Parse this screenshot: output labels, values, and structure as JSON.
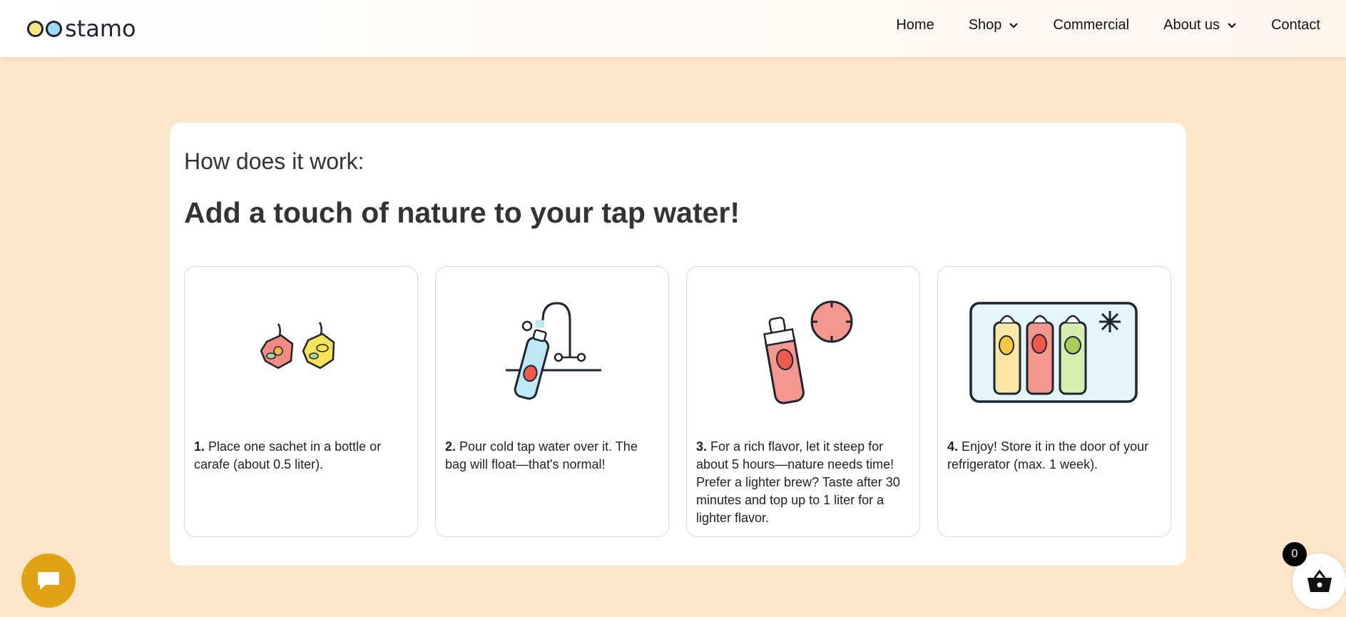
{
  "header": {
    "logo_text": "stamo",
    "nav": [
      {
        "label": "Home",
        "has_dropdown": false
      },
      {
        "label": "Shop",
        "has_dropdown": true
      },
      {
        "label": "Commercial",
        "has_dropdown": false
      },
      {
        "label": "About us",
        "has_dropdown": true
      },
      {
        "label": "Contact",
        "has_dropdown": false
      }
    ]
  },
  "main": {
    "kicker": "How does it work:",
    "headline": "Add a touch of nature to your tap water!",
    "steps": [
      {
        "num": "1.",
        "text": "Place one sachet in a bottle or carafe (about 0.5 liter).",
        "icon": "sachets-icon"
      },
      {
        "num": "2.",
        "text": "Pour cold tap water over it. The bag will float—that's normal!",
        "icon": "tap-bottle-icon"
      },
      {
        "num": "3.",
        "text": "For a rich flavor, let it steep for about 5 hours—nature needs time! Prefer a lighter brew? Taste after 30 minutes and top up to 1 liter for a lighter flavor.",
        "icon": "bottle-timer-icon"
      },
      {
        "num": "4.",
        "text": "Enjoy! Store it in the door of your refrigerator (max. 1 week).",
        "icon": "fridge-bottles-icon"
      }
    ]
  },
  "cart": {
    "count": "0"
  },
  "colors": {
    "background": "#fde7cb",
    "chat_button": "#e0a316",
    "accent_red": "#f28b82",
    "accent_yellow": "#f7e25c",
    "accent_blue": "#bde8f5"
  }
}
